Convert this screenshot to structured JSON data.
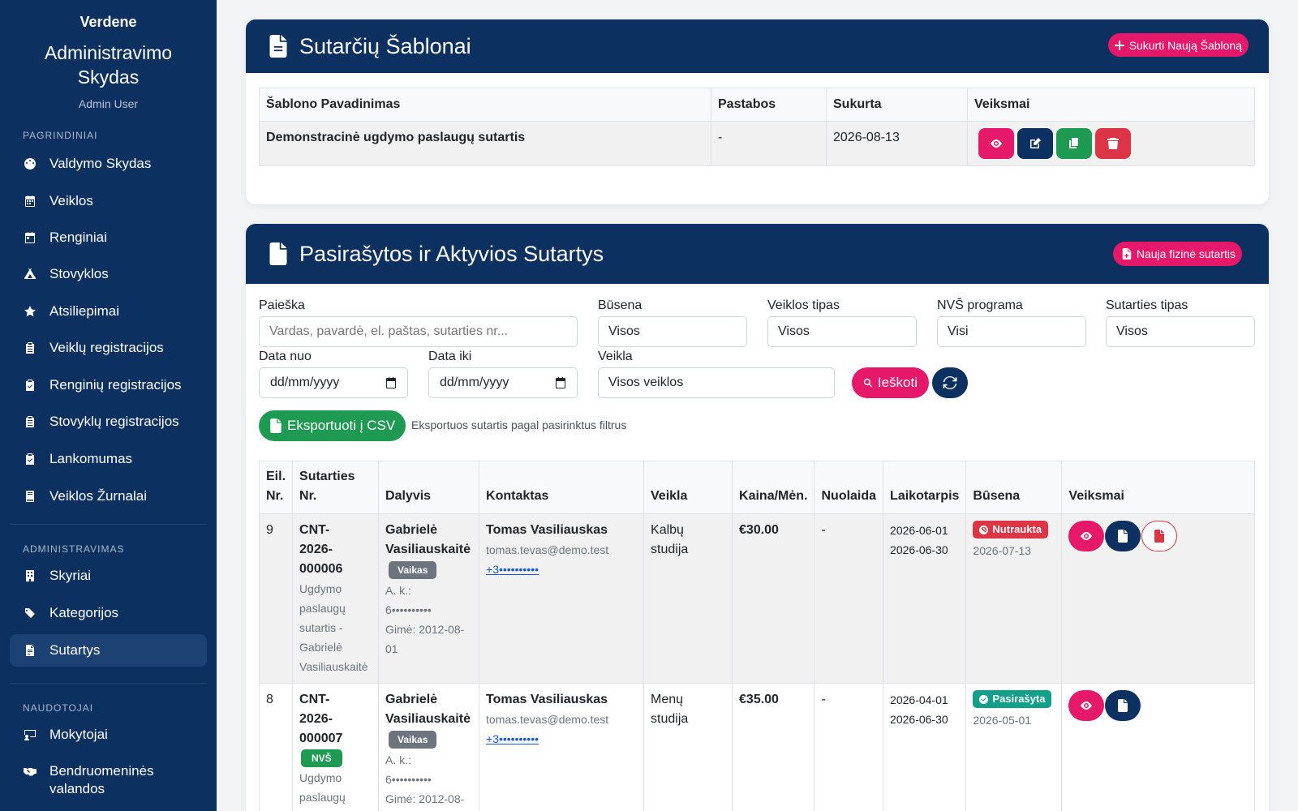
{
  "sidebar": {
    "brand": "Verdene",
    "title": "Administravimo Skydas",
    "user": "Admin User",
    "sections": {
      "main": "PAGRINDINIAI",
      "admin": "ADMINISTRAVIMAS",
      "users": "NAUDOTOJAI"
    },
    "items": {
      "dashboard": "Valdymo Skydas",
      "activities": "Veiklos",
      "events": "Renginiai",
      "camps": "Stovyklos",
      "reviews": "Atsiliepimai",
      "activity_regs": "Veiklų registracijos",
      "event_regs": "Renginių registracijos",
      "camp_regs": "Stovyklų registracijos",
      "attendance": "Lankomumas",
      "journals": "Veiklos Žurnalai",
      "departments": "Skyriai",
      "categories": "Kategorijos",
      "contracts": "Sutartys",
      "teachers": "Mokytojai",
      "community": "Bendruomeninės valandos"
    }
  },
  "templates": {
    "title": "Sutarčių Šablonai",
    "create_label": "Sukurti Naują Šabloną",
    "columns": [
      "Šablono Pavadinimas",
      "Pastabos",
      "Sukurta",
      "Veiksmai"
    ],
    "rows": [
      {
        "name": "Demonstracinė ugdymo paslaugų sutartis",
        "notes": "-",
        "created": "2026-08-13"
      }
    ]
  },
  "contracts": {
    "title": "Pasirašytos ir Aktyvios Sutartys",
    "new_label": "Nauja fizinė sutartis",
    "filters": {
      "search_label": "Paieška",
      "search_placeholder": "Vardas, pavardė, el. paštas, sutarties nr...",
      "status_label": "Būsena",
      "status_value": "Visos",
      "type_label": "Veiklos tipas",
      "type_value": "Visos",
      "nvs_label": "NVŠ programa",
      "nvs_value": "Visi",
      "contract_type_label": "Sutarties tipas",
      "contract_type_value": "Visos",
      "date_from_label": "Data nuo",
      "date_from_value": "dd/mm/yyyy",
      "date_to_label": "Data iki",
      "date_to_value": "dd/mm/yyyy",
      "activity_label": "Veikla",
      "activity_value": "Visos veiklos",
      "search_btn": "Ieškoti"
    },
    "export_label": "Eksportuoti į CSV",
    "export_note": "Eksportuos sutartis pagal pasirinktus filtrus",
    "columns": {
      "no_1": "Eil.",
      "no_2": "Nr.",
      "contract_1": "Sutarties",
      "contract_2": "Nr.",
      "participant": "Dalyvis",
      "contact": "Kontaktas",
      "activity": "Veikla",
      "price": "Kaina/Mėn.",
      "discount": "Nuolaida",
      "period": "Laikotarpis",
      "status": "Būsena",
      "actions": "Veiksmai"
    },
    "rows": [
      {
        "no": "9",
        "contract_l1": "CNT-",
        "contract_l2": "2026-",
        "contract_l3": "000006",
        "desc_l1": "Ugdymo",
        "desc_l2": "paslaugų",
        "desc_l3": "sutartis -",
        "desc_l4": "Gabrielė",
        "desc_l5": "Vasiliauskaitė",
        "participant_l1": "Gabrielė",
        "participant_l2": "Vasiliauskaitė",
        "role": "Vaikas",
        "ak_label": "A. k.:",
        "ak_value": "6••••••••••",
        "born_l1": "Gimė: 2012-08-",
        "born_l2": "01",
        "contact_name": "Tomas Vasiliauskas",
        "contact_email": "tomas.tevas@demo.test",
        "contact_phone": "+3••••••••••",
        "activity_l1": "Kalbų",
        "activity_l2": "studija",
        "price": "€30.00",
        "discount": "-",
        "period_from": "2026-06-01",
        "period_to": "2026-06-30",
        "status": "Nutraukta",
        "status_date": "2026-07-13"
      },
      {
        "no": "8",
        "contract_l1": "CNT-",
        "contract_l2": "2026-",
        "contract_l3": "000007",
        "nvs": "NVŠ",
        "desc_l1": "Ugdymo",
        "desc_l2": "paslaugų",
        "participant_l1": "Gabrielė",
        "participant_l2": "Vasiliauskaitė",
        "role": "Vaikas",
        "ak_label": "A. k.:",
        "ak_value": "6••••••••••",
        "born_l1": "Gimė: 2012-08-",
        "contact_name": "Tomas Vasiliauskas",
        "contact_email": "tomas.tevas@demo.test",
        "contact_phone": "+3••••••••••",
        "activity_l1": "Menų",
        "activity_l2": "studija",
        "price": "€35.00",
        "discount": "-",
        "period_from": "2026-04-01",
        "period_to": "2026-06-30",
        "status": "Pasirašyta",
        "status_date": "2026-05-01"
      }
    ]
  },
  "colors": {
    "navy": "#0c3160",
    "pink": "#e5186a",
    "green": "#1e9a53",
    "red": "#dc3545",
    "teal": "#13a08a"
  }
}
